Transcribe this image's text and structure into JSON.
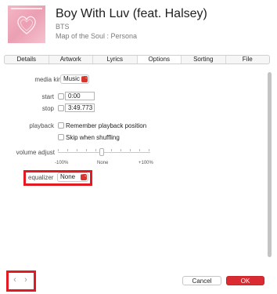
{
  "header": {
    "song_title": "Boy With Luv (feat. Halsey)",
    "artist": "BTS",
    "album": "Map of the Soul : Persona"
  },
  "tabs": [
    {
      "label": "Details"
    },
    {
      "label": "Artwork"
    },
    {
      "label": "Lyrics"
    },
    {
      "label": "Options",
      "active": true
    },
    {
      "label": "Sorting"
    },
    {
      "label": "File"
    }
  ],
  "options": {
    "media_kind_label": "media kind",
    "media_kind_value": "Music",
    "start_label": "start",
    "start_value": "0:00",
    "stop_label": "stop",
    "stop_value": "3:49.773",
    "playback_label": "playback",
    "remember_position_label": "Remember playback position",
    "skip_shuffle_label": "Skip when shuffling",
    "volume_label": "volume adjust",
    "volume_level_percent": 0,
    "volume_scale": [
      "-100%",
      "None",
      "+100%"
    ],
    "equalizer_label": "equalizer",
    "equalizer_value": "None"
  },
  "footer": {
    "prev_glyph": "‹",
    "next_glyph": "›",
    "cancel_label": "Cancel",
    "ok_label": "OK"
  },
  "colors": {
    "accent_red": "#d92b31",
    "highlight_red": "#e21b23"
  },
  "icons": {
    "popup_arrows": "⌃⌄"
  }
}
